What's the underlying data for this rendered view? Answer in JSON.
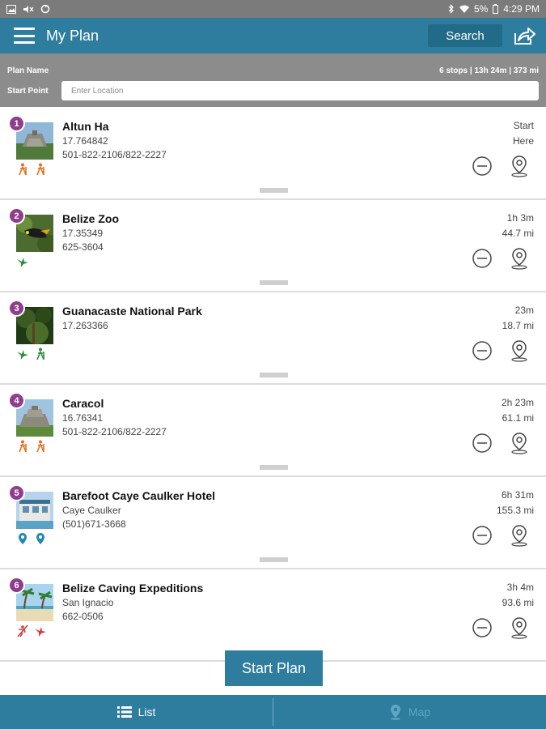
{
  "status_bar": {
    "left_icons": [
      "image-icon",
      "no-sound-icon",
      "sync-icon"
    ],
    "right": {
      "battery": "5%",
      "time": "4:29 PM"
    }
  },
  "app_bar": {
    "title": "My Plan",
    "search_label": "Search",
    "icons": {
      "menu": "menu-icon",
      "share": "share-icon"
    }
  },
  "plan": {
    "name_label": "Plan Name",
    "summary": "6 stops | 13h 24m | 373 mi",
    "start_point_label": "Start Point",
    "start_point_value": "",
    "start_point_placeholder": "Enter Location"
  },
  "stops": [
    {
      "num": "1",
      "name": "Altun Ha",
      "line1": "17.764842",
      "line2": "501-822-2106/822-2227",
      "time": "Start",
      "dist": "Here",
      "category_icons": [
        "hiker-icon",
        "hiker-icon"
      ],
      "icon_color": "#e4701e"
    },
    {
      "num": "2",
      "name": "Belize Zoo",
      "line1": "17.35349",
      "line2": "625-3604",
      "time": "1h 3m",
      "dist": "44.7 mi",
      "category_icons": [
        "bird-icon"
      ],
      "icon_color": "#2f8f3a"
    },
    {
      "num": "3",
      "name": "Guanacaste National Park",
      "line1": "17.263366",
      "line2": "",
      "time": "23m",
      "dist": "18.7 mi",
      "category_icons": [
        "bird-icon",
        "hiker-icon"
      ],
      "icon_color": "#2f8f3a"
    },
    {
      "num": "4",
      "name": "Caracol",
      "line1": "16.76341",
      "line2": "501-822-2106/822-2227",
      "time": "2h 23m",
      "dist": "61.1 mi",
      "category_icons": [
        "hiker-icon",
        "hiker-icon"
      ],
      "icon_color": "#e4701e"
    },
    {
      "num": "5",
      "name": "Barefoot Caye Caulker Hotel",
      "line1": "Caye Caulker",
      "line2": "(501)671-3668",
      "time": "6h 31m",
      "dist": "155.3 mi",
      "category_icons": [
        "location-pin-icon",
        "location-pin-icon"
      ],
      "icon_color": "#1f8bb3"
    },
    {
      "num": "6",
      "name": "Belize Caving Expeditions",
      "line1": "San Ignacio",
      "line2": "662-0506",
      "time": "3h 4m",
      "dist": "93.6 mi",
      "category_icons": [
        "rappel-icon",
        "bird-icon"
      ],
      "icon_color": "#d83a3a"
    }
  ],
  "start_plan_label": "Start Plan",
  "bottom_nav": {
    "list_label": "List",
    "map_label": "Map",
    "active": "List"
  },
  "colors": {
    "primary": "#2e7d9e",
    "badge": "#8e3e8c",
    "header_gray": "#8c8c8c"
  }
}
